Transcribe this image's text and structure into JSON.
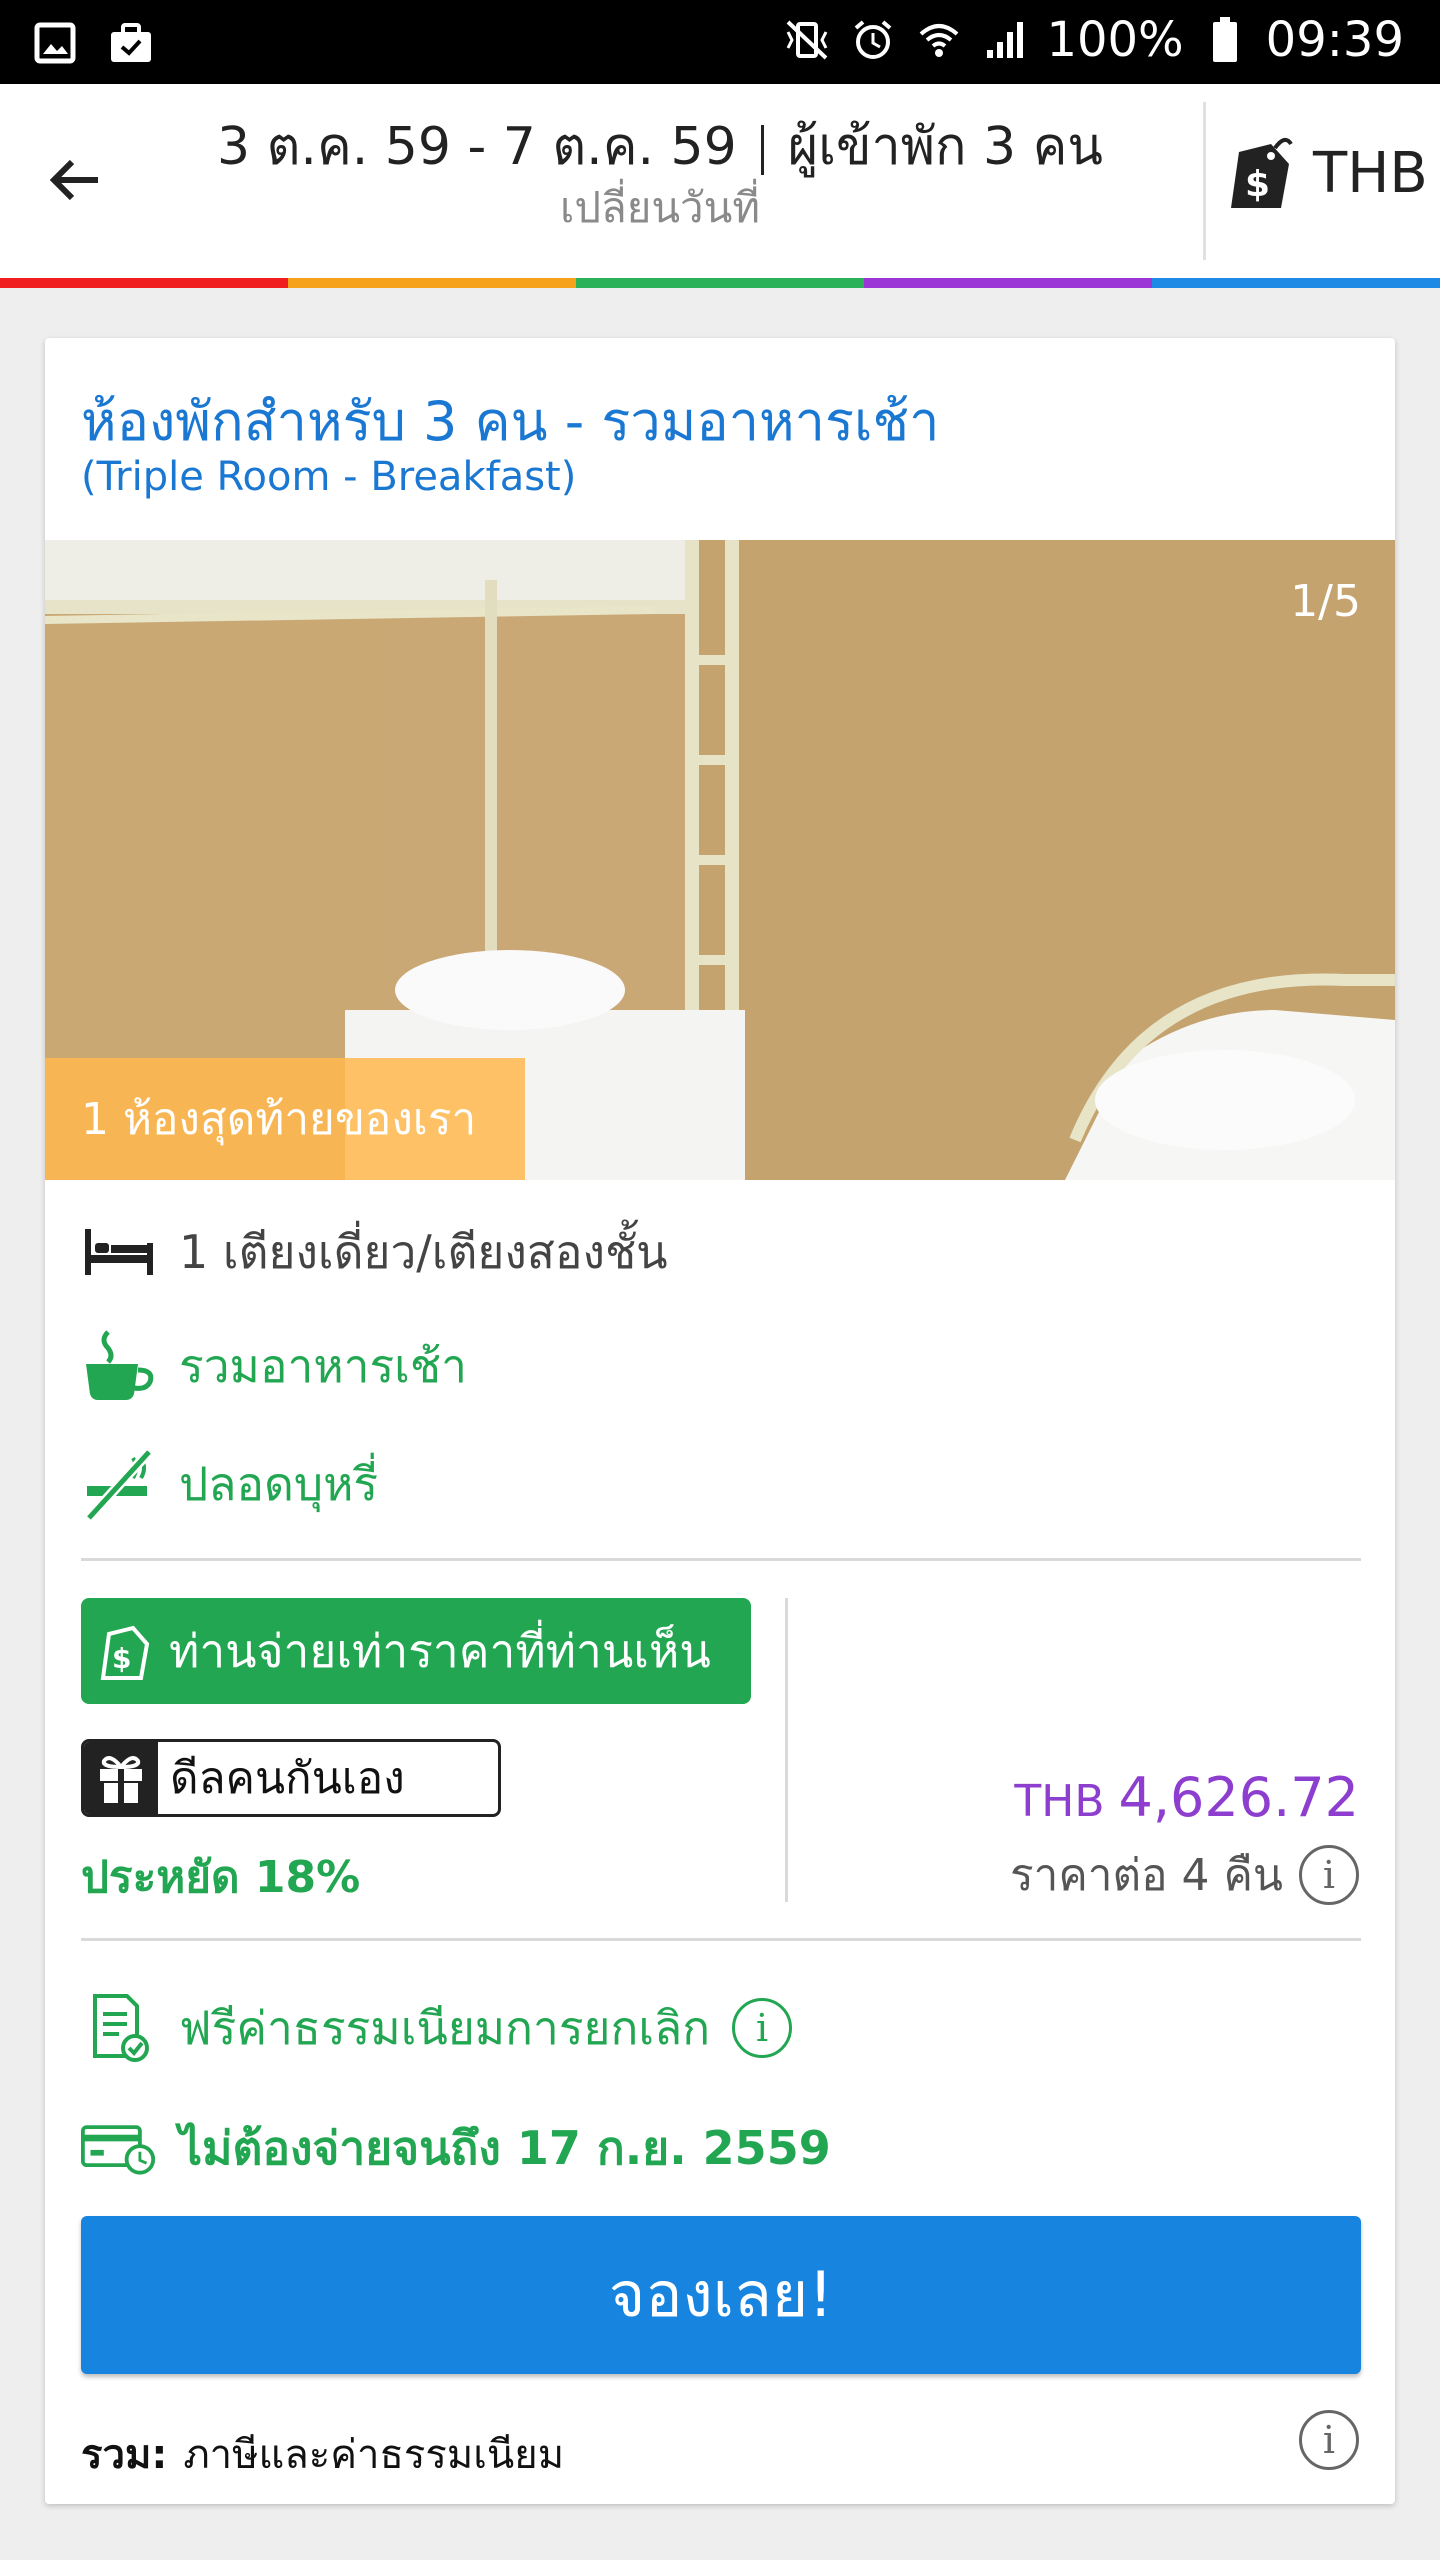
{
  "status_bar": {
    "battery": "100%",
    "time": "09:39"
  },
  "header": {
    "dates": "3 ต.ค. 59 - 7 ต.ค. 59",
    "guests": "ผู้เข้าพัก 3 คน",
    "change_date": "เปลี่ยนวันที่",
    "currency": "THB"
  },
  "rainbow_colors": [
    "#f01e1e",
    "#f7a21b",
    "#2bb259",
    "#9b35d6",
    "#1f8ae6"
  ],
  "room": {
    "title": "ห้องพักสำหรับ 3 คน - รวมอาหารเช้า",
    "subtitle": "(Triple Room - Breakfast)",
    "photo_counter": "1/5",
    "last_room_banner": "1 ห้องสุดท้ายของเรา",
    "features": {
      "bed": "1 เตียงเดี่ยว/เตียงสองชั้น",
      "breakfast": "รวมอาหารเช้า",
      "non_smoking": "ปลอดบุหรี่"
    }
  },
  "pricing": {
    "pay_badge": "ท่านจ่ายเท่าราคาที่ท่านเห็น",
    "deal_badge": "ดีลคนกันเอง",
    "savings": "ประหยัด 18%",
    "currency": "THB",
    "amount": "4,626.72",
    "per_nights": "ราคาต่อ 4 คืน"
  },
  "policies": {
    "free_cancel": "ฟรีค่าธรรมเนียมการยกเลิก",
    "pay_later": "ไม่ต้องจ่ายจนถึง 17 ก.ย. 2559"
  },
  "book_button": "จองเลย!",
  "total": {
    "label": "รวม:",
    "text": "ภาษีและค่าธรรมเนียม"
  },
  "colors": {
    "accent_blue": "#1785e0",
    "green": "#22a652",
    "price_purple": "#8e3ecf"
  }
}
